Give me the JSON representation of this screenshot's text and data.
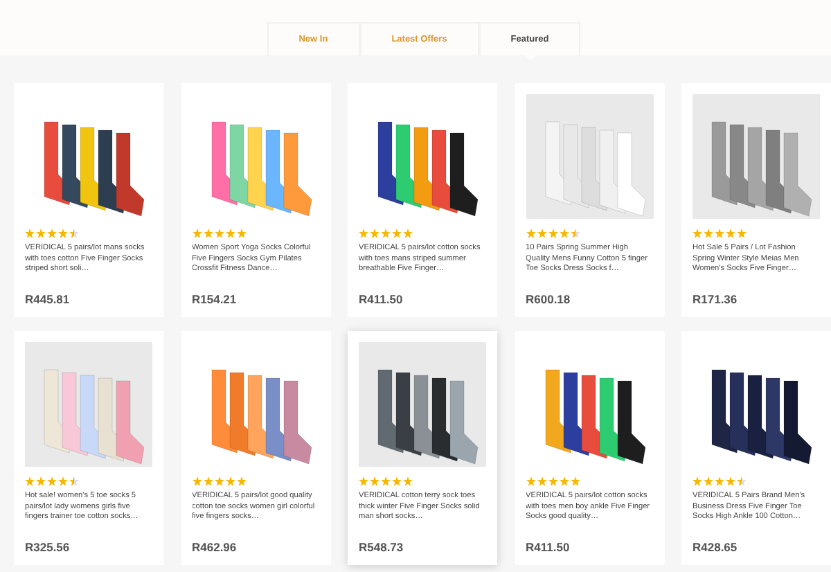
{
  "tabs": [
    {
      "label": "New In",
      "selected": false
    },
    {
      "label": "Latest Offers",
      "selected": false
    },
    {
      "label": "Featured",
      "selected": true
    }
  ],
  "products": [
    {
      "title": "VERIDICAL 5 pairs/lot mans socks with toes cotton Five Finger Socks striped short soli…",
      "price": "R445.81",
      "stars": 4.5,
      "highlighted": false
    },
    {
      "title": "Women Sport Yoga Socks Colorful Five Fingers Socks Gym Pilates Crossfit Fitness Dance…",
      "price": "R154.21",
      "stars": 5,
      "highlighted": false
    },
    {
      "title": "VERIDICAL 5 pairs/lot cotton socks with toes mans striped summer breathable Five Finger…",
      "price": "R411.50",
      "stars": 5,
      "highlighted": false
    },
    {
      "title": "10 Pairs Spring Summer High Quality Mens Funny Cotton 5 finger Toe Socks Dress Socks f…",
      "price": "R600.18",
      "stars": 4.5,
      "highlighted": false
    },
    {
      "title": "Hot Sale 5 Pairs / Lot Fashion Spring Winter Style Meias Men Women's Socks Five Finger…",
      "price": "R171.36",
      "stars": 5,
      "highlighted": false
    },
    {
      "title": "Hot sale! women's 5 toe socks 5 pairs/lot lady womens girls five fingers trainer toe cotton socks…",
      "price": "R325.56",
      "stars": 4.5,
      "highlighted": false
    },
    {
      "title": "VERIDICAL 5 pairs/lot good quality cotton toe socks women girl colorful five fingers socks…",
      "price": "R462.96",
      "stars": 5,
      "highlighted": false
    },
    {
      "title": "VERIDICAL cotton terry sock toes thick winter Five Finger Socks solid man short socks…",
      "price": "R548.73",
      "stars": 5,
      "highlighted": true
    },
    {
      "title": "VERIDICAL 5 pairs/lot cotton socks with toes men boy ankle Five Finger Socks good quality…",
      "price": "R411.50",
      "stars": 5,
      "highlighted": false
    },
    {
      "title": "VERIDICAL 5 Pairs Brand Men's Business Dress Five Finger Toe Socks High Ankle 100 Cotton…",
      "price": "R428.65",
      "stars": 4.5,
      "highlighted": false
    }
  ]
}
